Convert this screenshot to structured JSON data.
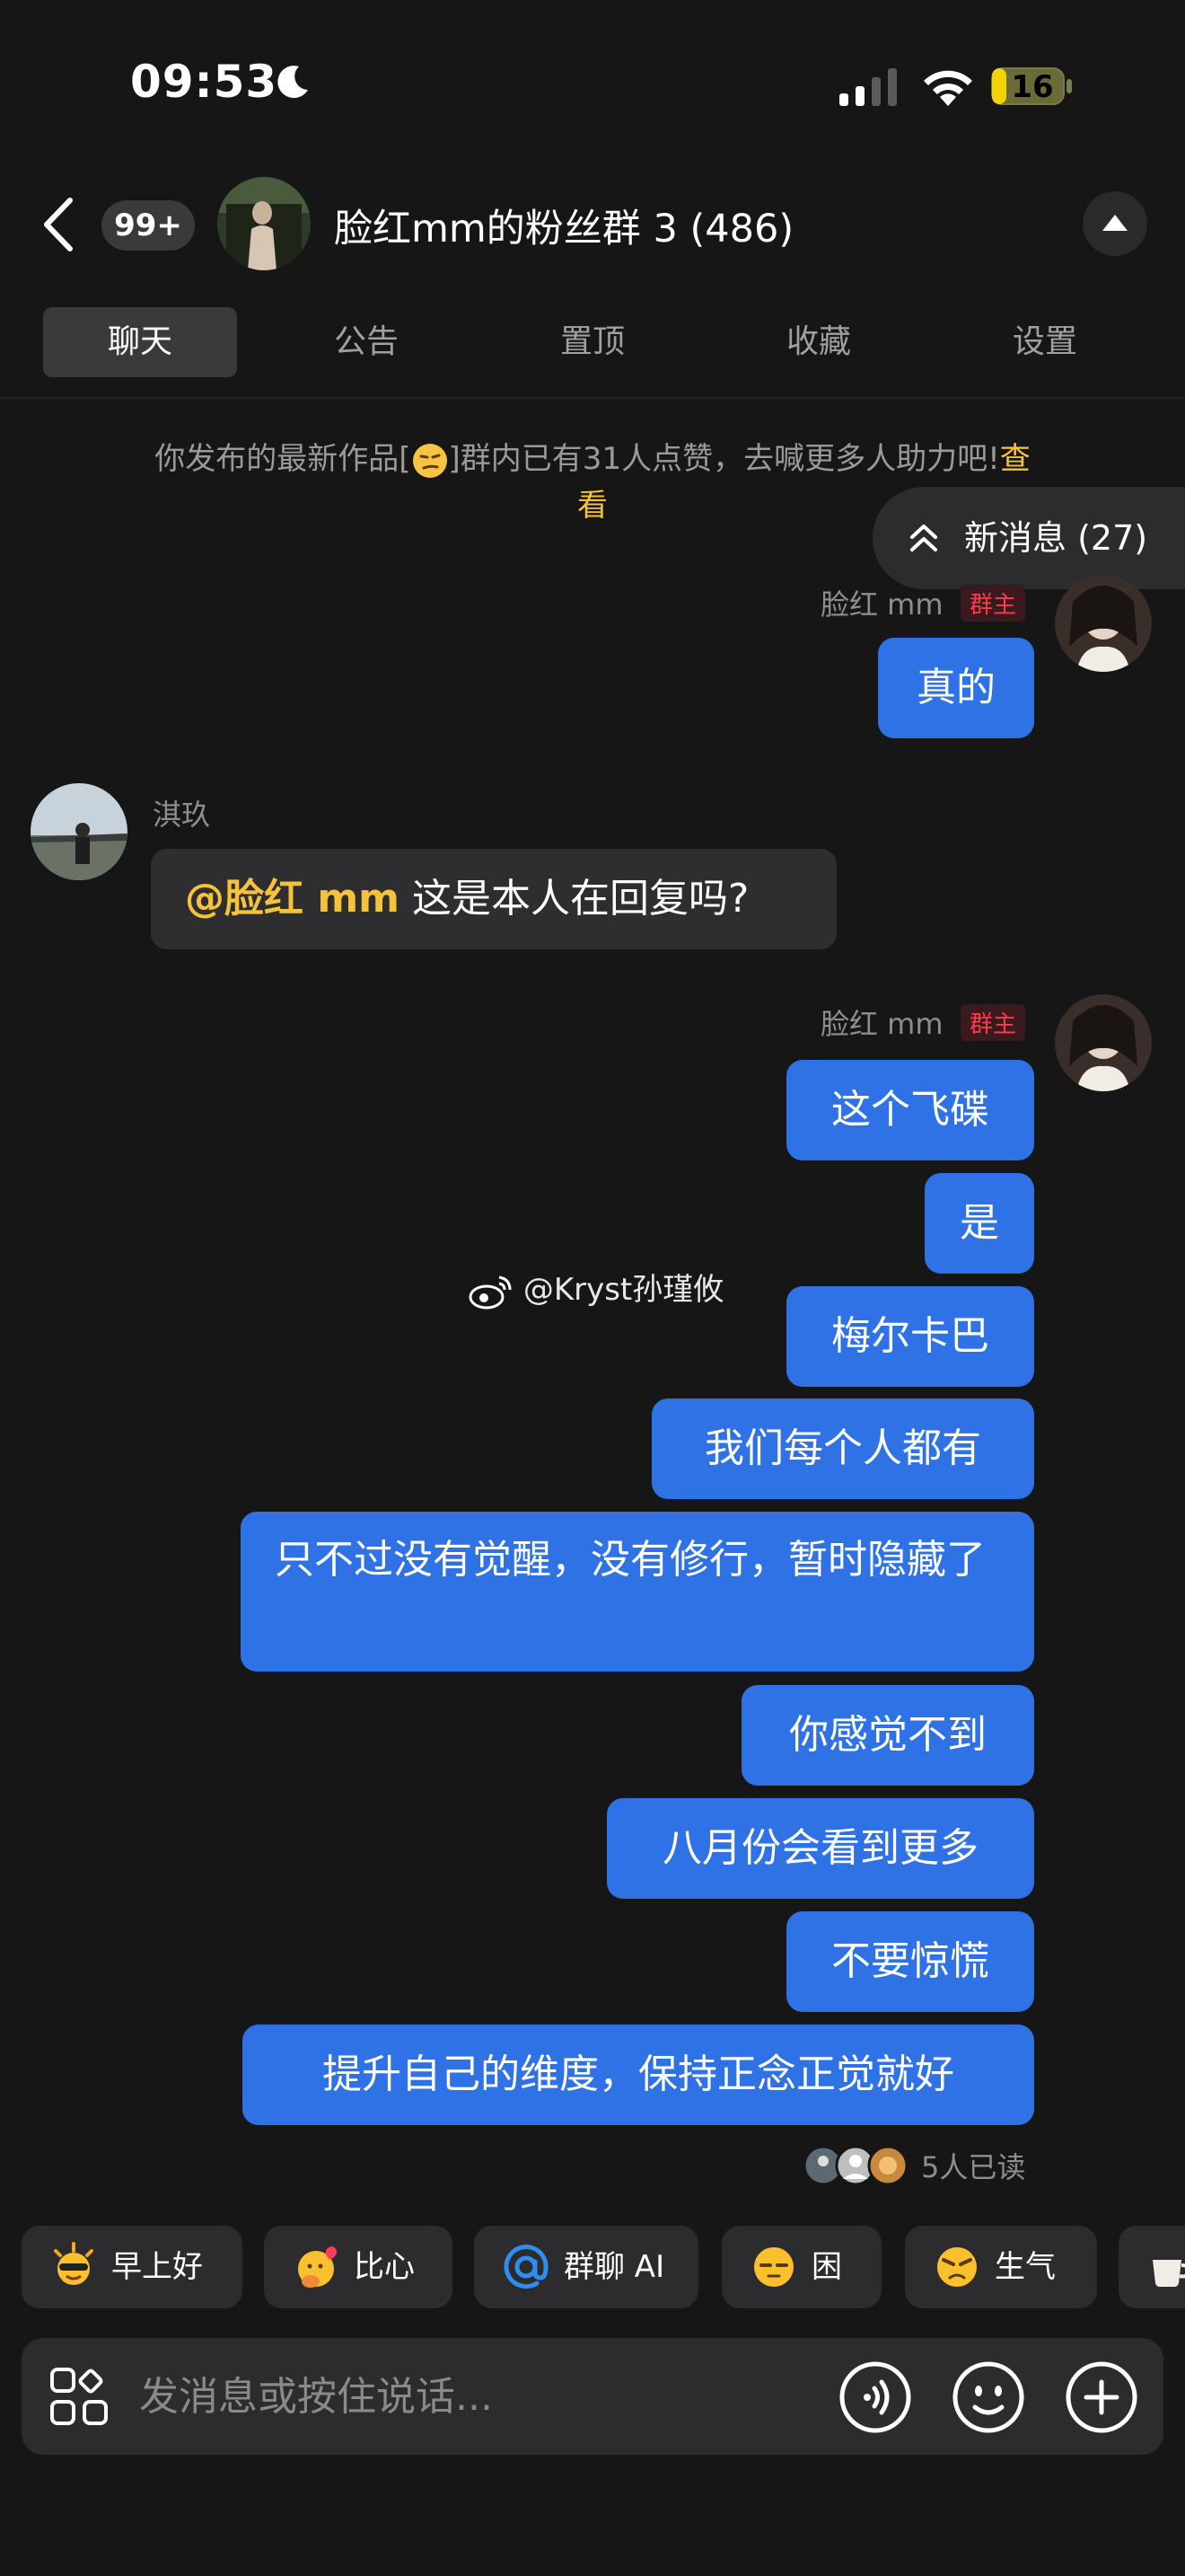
{
  "status_bar": {
    "time": "09:53",
    "battery": "16"
  },
  "header": {
    "unread_badge": "99+",
    "title": "脸红mm的粉丝群 3 (486)"
  },
  "tabs": [
    {
      "label": "聊天",
      "active": true
    },
    {
      "label": "公告"
    },
    {
      "label": "置顶"
    },
    {
      "label": "收藏"
    },
    {
      "label": "设置"
    }
  ],
  "notice": {
    "text_before": "你发布的最新作品[",
    "text_after": "]群内已有31人点赞，去喊更多人助力吧!",
    "link_line1": "查",
    "link_line2": "看"
  },
  "new_messages": {
    "label": "新消息 (27)"
  },
  "messages": {
    "owner_name": "脸红 mm",
    "owner_tag": "群主",
    "m1": "真的",
    "other_name": "淇玖",
    "m2_mention": "@脸红 mm",
    "m2_text": " 这是本人在回复吗?",
    "m3": "这个飞碟",
    "m4": "是",
    "m5": "梅尔卡巴",
    "m6": "我们每个人都有",
    "m7": "只不过没有觉醒，没有修行，暂时隐藏了",
    "m8": "你感觉不到",
    "m9": "八月份会看到更多",
    "m10": "不要惊慌",
    "m11": "提升自己的维度，保持正念正觉就好",
    "read_receipt": "5人已读"
  },
  "watermark": "@Kryst孙瑾攸",
  "quick_chips": [
    {
      "label": "早上好",
      "icon": "sun-emoji-icon"
    },
    {
      "label": "比心",
      "icon": "heart-hand-emoji-icon"
    },
    {
      "label": "群聊 AI",
      "icon": "at-icon"
    },
    {
      "label": "困",
      "icon": "sleepy-emoji-icon"
    },
    {
      "label": "生气",
      "icon": "angry-emoji-icon"
    }
  ],
  "input": {
    "placeholder": "发消息或按住说话..."
  },
  "colors": {
    "background": "#161616",
    "bubble_self": "#2f72e5",
    "bubble_other": "#2e2e30",
    "mention": "#f5c33b",
    "owner_tag": "#ff3b4b"
  }
}
